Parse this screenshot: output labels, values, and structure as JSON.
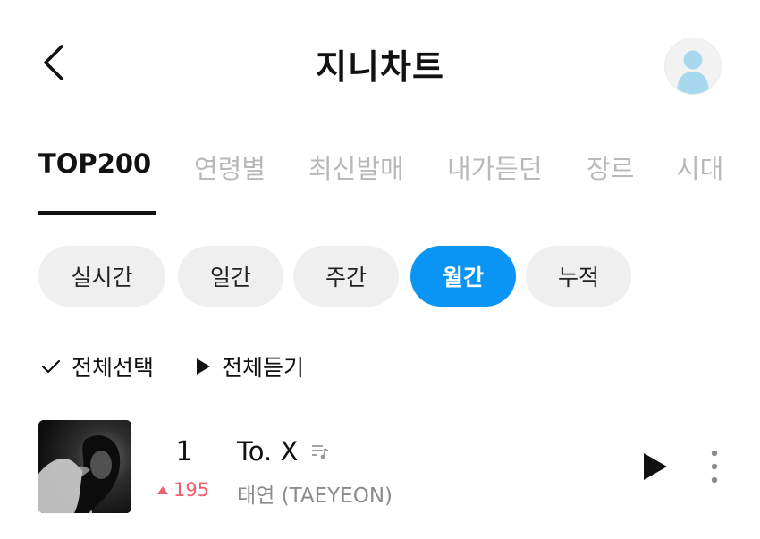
{
  "header": {
    "title": "지니차트",
    "back_icon": "chevron-left-icon",
    "profile_icon": "user-avatar-icon",
    "avatar_color": "#a7d8ee"
  },
  "tabs": [
    {
      "label": "TOP200",
      "active": true
    },
    {
      "label": "연령별",
      "active": false
    },
    {
      "label": "최신발매",
      "active": false
    },
    {
      "label": "내가듣던",
      "active": false
    },
    {
      "label": "장르",
      "active": false
    },
    {
      "label": "시대",
      "active": false
    }
  ],
  "period_filters": [
    {
      "label": "실시간",
      "active": false
    },
    {
      "label": "일간",
      "active": false
    },
    {
      "label": "주간",
      "active": false
    },
    {
      "label": "월간",
      "active": true
    },
    {
      "label": "누적",
      "active": false
    }
  ],
  "actions": {
    "select_all": "전체선택",
    "play_all": "전체듣기"
  },
  "songs": [
    {
      "rank": "1",
      "rank_change": "195",
      "rank_change_direction": "up",
      "title": "To. X",
      "artist": "태연 (TAEYEON)",
      "lyrics_icon": "lyrics-icon"
    }
  ],
  "colors": {
    "accent": "#0a95f5",
    "rank_up": "#f0606a",
    "inactive_tab": "#b9b9b9"
  }
}
